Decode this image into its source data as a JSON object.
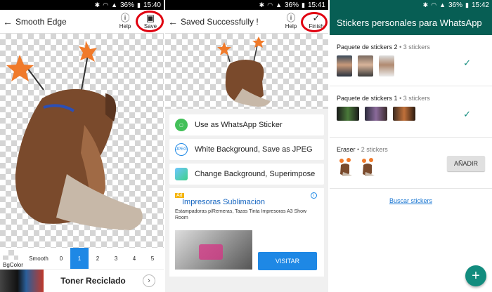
{
  "status_bars": [
    {
      "battery": "36%",
      "time": "15:40"
    },
    {
      "battery": "36%",
      "time": "15:41"
    },
    {
      "battery": "36%",
      "time": "15:42"
    }
  ],
  "panel1": {
    "title": "Smooth Edge",
    "help_label": "Help",
    "save_label": "Save",
    "bgcolor_label": "BgColor",
    "smooth_label": "Smooth",
    "smooth_levels": [
      "0",
      "1",
      "2",
      "3",
      "4",
      "5"
    ],
    "selected_level": "1",
    "ad_text": "Toner Reciclado",
    "ad_chevron": "›"
  },
  "panel2": {
    "title": "Saved Successfully !",
    "help_label": "Help",
    "finish_label": "Finish",
    "options": [
      {
        "label": "Use as WhatsApp Sticker",
        "icon": "whatsapp-sticker-icon",
        "icon_text": ""
      },
      {
        "label": "White Background, Save as JPEG",
        "icon": "jpeg-icon",
        "icon_text": "JPEG"
      },
      {
        "label": "Change Background, Superimpose",
        "icon": "superimpose-icon",
        "icon_text": ""
      }
    ],
    "ad": {
      "tag": "Ad",
      "title": "Impresoras Sublimacion",
      "description": "Estampadoras p/Remeras, Tazas Tinta Impresoras A3 Show Room",
      "button": "VISITAR"
    }
  },
  "panel3": {
    "header": "Stickers personales para WhatsApp",
    "packs": [
      {
        "name": "Paquete de stickers 2",
        "count": "3 stickers",
        "state": "added"
      },
      {
        "name": "Paquete de stickers 1",
        "count": "3 stickers",
        "state": "added"
      },
      {
        "name": "Eraser",
        "count": "2 stickers",
        "state": "add",
        "button": "AÑADIR"
      }
    ],
    "link": "Buscar stickers",
    "fab": "+"
  },
  "colors": {
    "accent_blue": "#1e88e5",
    "whatsapp_green": "#075e54",
    "whatsapp_teal": "#128c7e",
    "highlight_red": "#e0000f"
  }
}
